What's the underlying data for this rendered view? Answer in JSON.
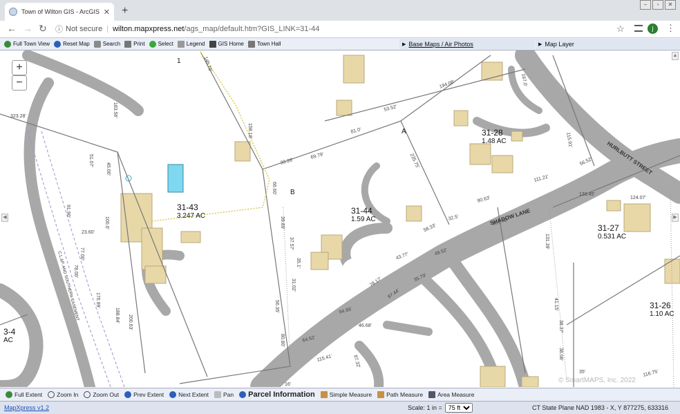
{
  "browser": {
    "tab_title": "Town of Wilton GIS - ArcGIS Server",
    "new_tab": "+",
    "not_secure": "Not secure",
    "url_host": "wilton.mapxpress.net",
    "url_path": "/ags_map/default.htm?GIS_LINK=31-44",
    "profile_initial": "j"
  },
  "toolbar": {
    "full_town_view": "Full Town View",
    "reset_map": "Reset Map",
    "search": "Search",
    "print": "Print",
    "select": "Select",
    "legend": "Legend",
    "gis_home": "GIS Home",
    "town_hall": "Town Hall",
    "base_maps": "Base Maps / Air Photos",
    "map_layer": "Map Layer"
  },
  "map": {
    "zoom_in": "+",
    "zoom_out": "−",
    "parcels": [
      {
        "id": "31-43",
        "area": "3.247 AC"
      },
      {
        "id": "31-44",
        "area": "1.59 AC"
      },
      {
        "id": "31-28",
        "area": "1.48 AC"
      },
      {
        "id": "31-27",
        "area": "0.531 AC"
      },
      {
        "id": "31-26",
        "area": "1.10 AC"
      },
      {
        "id": "3-4",
        "area": "AC"
      }
    ],
    "streets": [
      "HURLBUTT STREET",
      "SHADOW LANE"
    ],
    "easement": "C.L.&P. AND SOUTHERN EASEMENT",
    "letters": [
      "1",
      "A",
      "B"
    ],
    "dimensions": [
      "145.79'",
      "194.08'",
      "167.0'",
      "323.28'",
      "183.56'",
      "158.18'",
      "53.52'",
      "81.0'",
      "69.79'",
      "33.26'",
      "235.75'",
      "115.91'",
      "56.52'",
      "51.07'",
      "45.00'",
      "66.60'",
      "111.21'",
      "124.07'",
      "133.45'",
      "91.90'",
      "100.0'",
      "23.60'",
      "39.89'",
      "90.63'",
      "32.5'",
      "167.78'",
      "77.00'",
      "78.00'",
      "37.57'",
      "35.1'",
      "58.33'",
      "43.77'",
      "49.52'",
      "131.39'",
      "31.02'",
      "35.79'",
      "78.17'",
      "97.44'",
      "41.15'",
      "176.99'",
      "56.35'",
      "94.85'",
      "38.37'",
      "188.84'",
      "200.63'",
      "80.80'",
      "64.52'",
      "46.68'",
      "38.08'",
      "115.41'",
      "87.32'",
      "35'",
      "116.75'",
      "16'"
    ],
    "watermark": "© SmartMAPS, Inc. 2022"
  },
  "bottom_toolbar": {
    "full_extent": "Full Extent",
    "zoom_in": "Zoom In",
    "zoom_out": "Zoom Out",
    "prev_extent": "Prev Extent",
    "next_extent": "Next Extent",
    "pan": "Pan",
    "parcel_information": "Parcel Information",
    "simple_measure": "Simple Measure",
    "path_measure": "Path Measure",
    "area_measure": "Area Measure"
  },
  "status": {
    "version_link": "MapXpress v1.2",
    "scale_label": "Scale: 1 in =",
    "scale_value": "75 ft",
    "coordinates": "CT State Plane NAD 1983 - X, Y   877275, 633316"
  },
  "colors": {
    "building": "#e8d8a8",
    "road": "#a8a8a8",
    "pool": "#7dd8f0",
    "toolbar": "#e9eef7"
  }
}
